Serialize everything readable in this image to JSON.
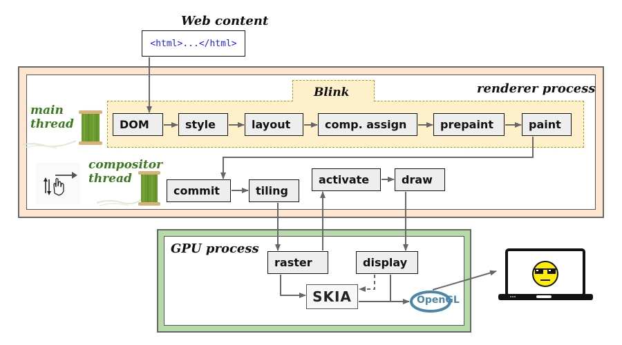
{
  "web_content": {
    "title": "Web content",
    "code": "<html>...</html>"
  },
  "renderer": {
    "title": "renderer process",
    "blink_label": "Blink",
    "main_thread_label": [
      "main",
      "thread"
    ],
    "compositor_thread_label": [
      "compositor",
      "thread"
    ],
    "pipeline": [
      "DOM",
      "style",
      "layout",
      "comp. assign",
      "prepaint",
      "paint"
    ],
    "compositor_nodes": {
      "commit": "commit",
      "tiling": "tiling",
      "activate": "activate",
      "draw": "draw"
    }
  },
  "gpu": {
    "title": "GPU process",
    "raster": "raster",
    "display": "display",
    "skia": "SKIA",
    "opengl": "OpenGL"
  },
  "colors": {
    "renderer_bg": "#fde5cf",
    "blink_bg": "#fff0cc",
    "gpu_bg": "#b7dba8",
    "thread_label": "#3a7a1e",
    "code_text": "#1a1aff",
    "node_fill": "#eeeeee",
    "arrow": "#666666"
  }
}
